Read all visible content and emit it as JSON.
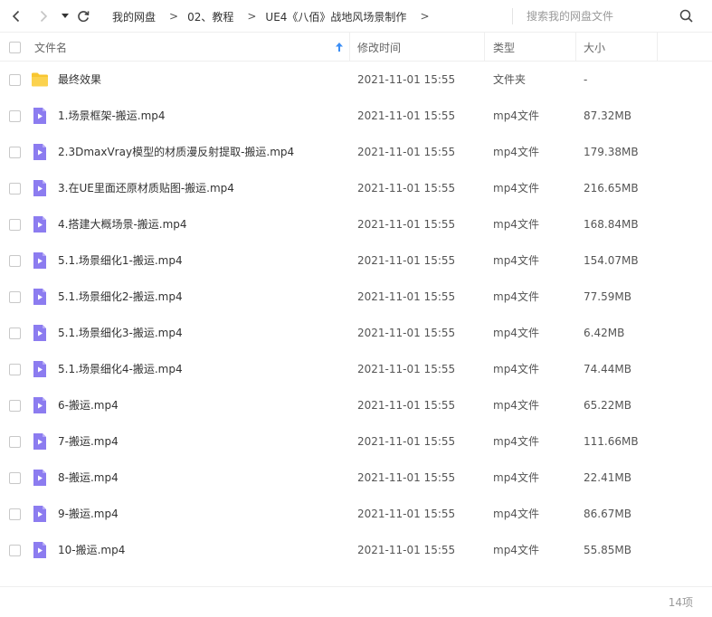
{
  "toolbar": {
    "icons": {
      "back": "chevron-left-icon",
      "forward": "chevron-right-icon",
      "history": "caret-down-icon",
      "refresh": "refresh-icon",
      "search": "search-icon"
    },
    "breadcrumb": [
      "我的网盘",
      "02、教程",
      "UE4《八佰》战地风场景制作"
    ],
    "crumb_separator": ">",
    "search_placeholder": "搜索我的网盘文件"
  },
  "table": {
    "columns": {
      "name": "文件名",
      "modified": "修改时间",
      "type": "类型",
      "size": "大小"
    },
    "sort": {
      "column": "name",
      "direction": "ascending",
      "icon": "arrow-up-icon"
    },
    "rows": [
      {
        "name": "最终效果",
        "modified": "2021-11-01 15:55",
        "type": "文件夹",
        "size": "-",
        "icon": "folder-icon"
      },
      {
        "name": "1.场景框架-搬运.mp4",
        "modified": "2021-11-01 15:55",
        "type": "mp4文件",
        "size": "87.32MB",
        "icon": "video-file-icon"
      },
      {
        "name": "2.3DmaxVray模型的材质漫反射提取-搬运.mp4",
        "modified": "2021-11-01 15:55",
        "type": "mp4文件",
        "size": "179.38MB",
        "icon": "video-file-icon"
      },
      {
        "name": "3.在UE里面还原材质贴图-搬运.mp4",
        "modified": "2021-11-01 15:55",
        "type": "mp4文件",
        "size": "216.65MB",
        "icon": "video-file-icon"
      },
      {
        "name": "4.搭建大概场景-搬运.mp4",
        "modified": "2021-11-01 15:55",
        "type": "mp4文件",
        "size": "168.84MB",
        "icon": "video-file-icon"
      },
      {
        "name": "5.1.场景细化1-搬运.mp4",
        "modified": "2021-11-01 15:55",
        "type": "mp4文件",
        "size": "154.07MB",
        "icon": "video-file-icon"
      },
      {
        "name": "5.1.场景细化2-搬运.mp4",
        "modified": "2021-11-01 15:55",
        "type": "mp4文件",
        "size": "77.59MB",
        "icon": "video-file-icon"
      },
      {
        "name": "5.1.场景细化3-搬运.mp4",
        "modified": "2021-11-01 15:55",
        "type": "mp4文件",
        "size": "6.42MB",
        "icon": "video-file-icon"
      },
      {
        "name": "5.1.场景细化4-搬运.mp4",
        "modified": "2021-11-01 15:55",
        "type": "mp4文件",
        "size": "74.44MB",
        "icon": "video-file-icon"
      },
      {
        "name": "6-搬运.mp4",
        "modified": "2021-11-01 15:55",
        "type": "mp4文件",
        "size": "65.22MB",
        "icon": "video-file-icon"
      },
      {
        "name": "7-搬运.mp4",
        "modified": "2021-11-01 15:55",
        "type": "mp4文件",
        "size": "111.66MB",
        "icon": "video-file-icon"
      },
      {
        "name": "8-搬运.mp4",
        "modified": "2021-11-01 15:55",
        "type": "mp4文件",
        "size": "22.41MB",
        "icon": "video-file-icon"
      },
      {
        "name": "9-搬运.mp4",
        "modified": "2021-11-01 15:55",
        "type": "mp4文件",
        "size": "86.67MB",
        "icon": "video-file-icon"
      },
      {
        "name": "10-搬运.mp4",
        "modified": "2021-11-01 15:55",
        "type": "mp4文件",
        "size": "55.85MB",
        "icon": "video-file-icon"
      }
    ]
  },
  "footer": {
    "count": "14项"
  },
  "colors": {
    "folder": "#f8c630",
    "video": "#8c7cf0",
    "sort_arrow": "#3b8ef5",
    "border": "#eeeeee"
  }
}
